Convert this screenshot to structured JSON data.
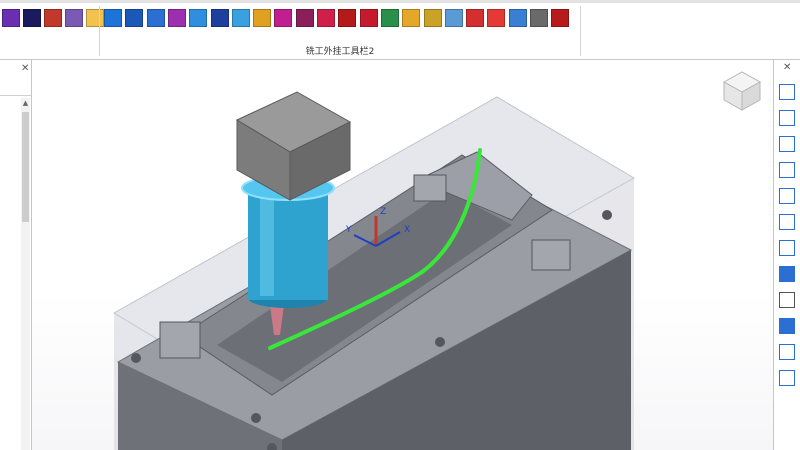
{
  "ribbon": {
    "toolbar_caption": "铣工外挂工具栏2",
    "left_group_icons": [
      {
        "name": "render-a-icon",
        "color": "#6a2fb0"
      },
      {
        "name": "render-b-icon",
        "color": "#1a1a5e"
      },
      {
        "name": "gear-red-icon",
        "color": "#c0392b"
      },
      {
        "name": "cube-icon",
        "color": "#7a5ab5"
      },
      {
        "name": "document-icon",
        "color": "#f2c14e"
      }
    ],
    "main_group_icons": [
      {
        "name": "sphere-icon",
        "color": "#1e73d6"
      },
      {
        "name": "layers-icon",
        "color": "#1b58b8"
      },
      {
        "name": "toolpath-a-icon",
        "color": "#2b6fd3"
      },
      {
        "name": "grid-a-icon",
        "color": "#9b2fb0"
      },
      {
        "name": "grid-b-icon",
        "color": "#2f8fdf"
      },
      {
        "name": "grid-c-icon",
        "color": "#1f3f9f"
      },
      {
        "name": "multicolor-a-icon",
        "color": "#3aa0e0"
      },
      {
        "name": "lightning-icon",
        "color": "#e0a020"
      },
      {
        "name": "contour-a-icon",
        "color": "#c0208f"
      },
      {
        "name": "contour-b-icon",
        "color": "#8a1f5a"
      },
      {
        "name": "contour-c-icon",
        "color": "#d0204a"
      },
      {
        "name": "contour-d-icon",
        "color": "#b31b1b"
      },
      {
        "name": "contour-e-icon",
        "color": "#c41a2c"
      },
      {
        "name": "pencil-icon",
        "color": "#2a8f4a"
      },
      {
        "name": "brush-icon",
        "color": "#e4a72a"
      },
      {
        "name": "scissors-icon",
        "color": "#c9a227"
      },
      {
        "name": "tool-stack-icon",
        "color": "#5a9bd6"
      },
      {
        "name": "number-badge-icon",
        "color": "#d32f2f"
      },
      {
        "name": "red-sheet-icon",
        "color": "#e53935"
      },
      {
        "name": "gear-blue-icon",
        "color": "#3b7fd4"
      },
      {
        "name": "report-icon",
        "color": "#6a6a6a"
      },
      {
        "name": "screen-icon",
        "color": "#b71c1c"
      }
    ]
  },
  "right_toolbar": [
    {
      "name": "view-fit-icon",
      "color": "#2b6fd3"
    },
    {
      "name": "view-iso-icon",
      "color": "#2b6fd3"
    },
    {
      "name": "view-cube-icon",
      "color": "#2b6fd3"
    },
    {
      "name": "zoom-rotate-icon",
      "color": "#2b6fd3"
    },
    {
      "name": "page-refresh-icon",
      "color": "#2b6fd3"
    },
    {
      "name": "zoom-window-icon",
      "color": "#2b6fd3"
    },
    {
      "name": "zoom-arrow-icon",
      "color": "#2b6fd3"
    },
    {
      "name": "shaded-view-icon",
      "color": "#2b6fd3"
    },
    {
      "name": "wireframe-view-icon",
      "color": "#555555"
    },
    {
      "name": "shaded-edges-icon",
      "color": "#2b6fd3"
    },
    {
      "name": "select-box-icon",
      "color": "#2b6fd3"
    },
    {
      "name": "select-undo-icon",
      "color": "#2b6fd3"
    }
  ],
  "viewport": {
    "axis_labels": {
      "x": "X",
      "y": "Y",
      "z": "Z"
    },
    "colors": {
      "stock": "#8c8e96",
      "toolpath": "#39e63a",
      "spindle": "#2fa3cf",
      "motor": "#7b7b7b",
      "axis_x": "#1f3fbf",
      "axis_y": "#1f3fbf",
      "axis_z": "#c0392b"
    }
  }
}
